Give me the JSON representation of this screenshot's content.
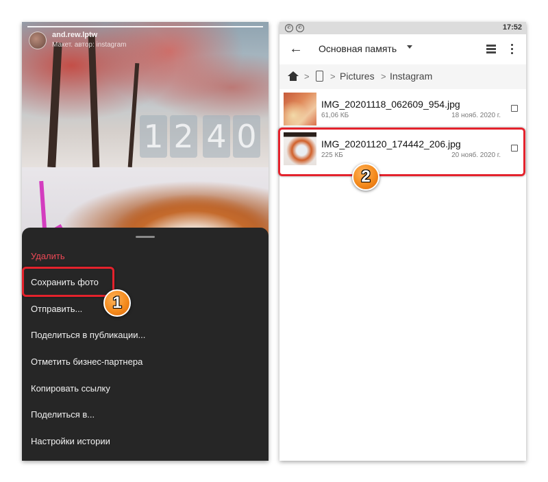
{
  "story": {
    "username": "and.rew.lptw",
    "subtitle": "Макет. автор: instagram",
    "clock_digits": [
      "1",
      "2",
      "4",
      "0"
    ]
  },
  "menu": {
    "items": [
      {
        "label": "Удалить",
        "danger": true
      },
      {
        "label": "Сохранить фото"
      },
      {
        "label": "Отправить..."
      },
      {
        "label": "Поделиться в публикации..."
      },
      {
        "label": "Отметить бизнес-партнера"
      },
      {
        "label": "Копировать ссылку"
      },
      {
        "label": "Поделиться в..."
      },
      {
        "label": "Настройки истории"
      }
    ]
  },
  "status_bar": {
    "time": "17:52",
    "icons": [
      "whatsapp-icon",
      "viber-icon"
    ]
  },
  "file_manager": {
    "title": "Основная память",
    "breadcrumb": [
      "Pictures",
      "Instagram"
    ],
    "files": [
      {
        "name": "IMG_20201118_062609_954.jpg",
        "size": "61,06 КБ",
        "date": "18 нояб. 2020 г."
      },
      {
        "name": "IMG_20201120_174442_206.jpg",
        "size": "225 КБ",
        "date": "20 нояб. 2020 г."
      }
    ]
  },
  "annotations": {
    "step1": "1",
    "step2": "2",
    "highlight_color": "#e4222c",
    "badge_color": "#f48a1c"
  },
  "colors": {
    "danger": "#ed4956",
    "menu_bg": "#262626"
  }
}
